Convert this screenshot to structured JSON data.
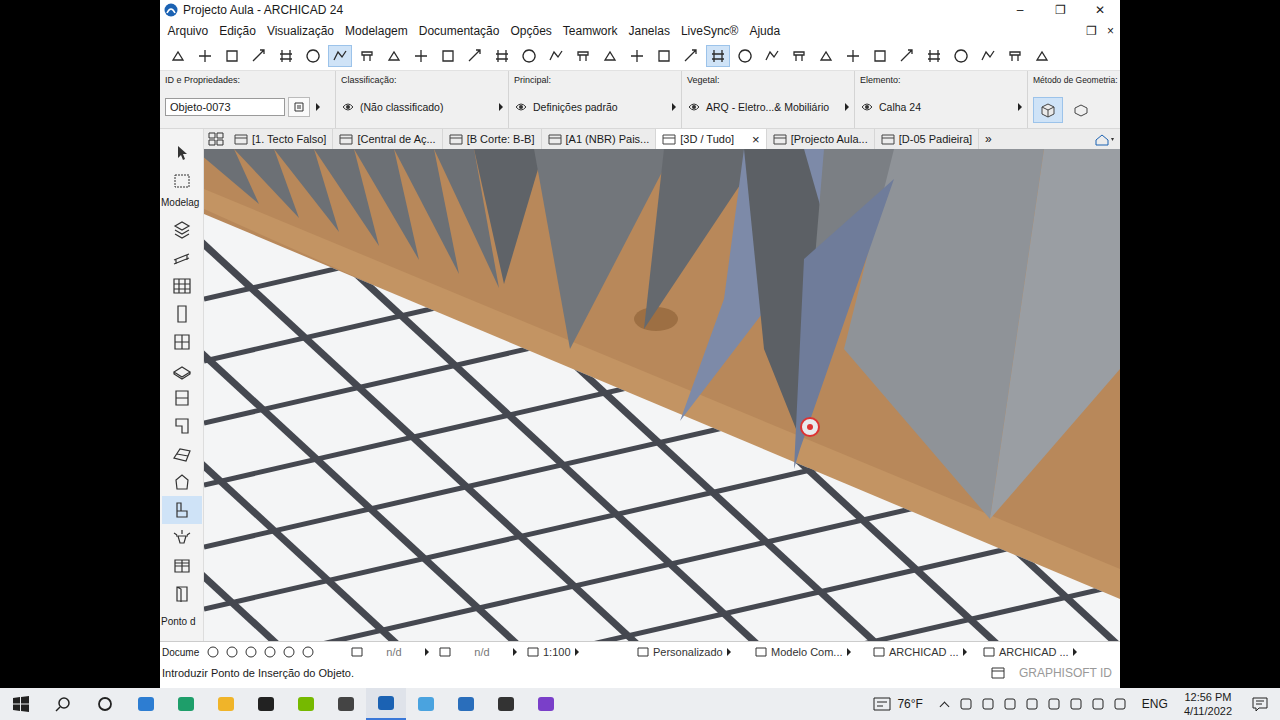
{
  "window": {
    "title": "Projecto Aula - ARCHICAD 24",
    "controls": [
      "–",
      "❐",
      "✕"
    ]
  },
  "menu": {
    "items": [
      "Arquivo",
      "Edição",
      "Visualização",
      "Modelagem",
      "Documentação",
      "Opções",
      "Teamwork",
      "Janelas",
      "LiveSync®",
      "Ajuda"
    ],
    "controls": [
      "❐",
      "×"
    ]
  },
  "toolbar": [
    {
      "selected": false
    },
    {
      "selected": false
    },
    {
      "selected": false
    },
    {
      "selected": false
    },
    {
      "selected": false
    },
    {
      "selected": false
    },
    {
      "selected": true
    },
    {
      "selected": false
    },
    {
      "selected": false
    },
    {
      "selected": false
    },
    {
      "selected": false
    },
    {
      "selected": false
    },
    {
      "selected": false
    },
    {
      "selected": false
    },
    {
      "selected": false
    },
    {
      "selected": false
    },
    {
      "selected": false
    },
    {
      "selected": false
    },
    {
      "selected": false
    },
    {
      "selected": false
    },
    {
      "selected": true
    },
    {
      "selected": false
    },
    {
      "selected": false
    },
    {
      "selected": false
    },
    {
      "selected": false
    },
    {
      "selected": false
    },
    {
      "selected": false
    },
    {
      "selected": false
    },
    {
      "selected": false
    },
    {
      "selected": false
    },
    {
      "selected": false
    },
    {
      "selected": false
    },
    {
      "selected": false
    }
  ],
  "infobox": [
    {
      "kind": "field",
      "label": "ID e Propriedades:",
      "value": "Objeto-0073"
    },
    {
      "kind": "picker",
      "label": "Classificação:",
      "value": "(Não classificado)"
    },
    {
      "kind": "picker",
      "label": "Principal:",
      "value": "Definições padrão"
    },
    {
      "kind": "picker",
      "label": "Vegetal:",
      "value": "ARQ - Eletro...& Mobiliário"
    },
    {
      "kind": "picker",
      "label": "Elemento:",
      "value": "Calha 24"
    },
    {
      "kind": "buttons",
      "label": "Método de Geometria:"
    }
  ],
  "tabs": [
    {
      "label": "[1. Tecto Falso]",
      "selected": false,
      "closable": false
    },
    {
      "label": "[Central de Aç...",
      "selected": false,
      "closable": false
    },
    {
      "label": "[B Corte: B-B]",
      "selected": false,
      "closable": false
    },
    {
      "label": "[A1 (NBR) Pais...",
      "selected": false,
      "closable": false
    },
    {
      "label": "[3D / Tudo]",
      "selected": true,
      "closable": true
    },
    {
      "label": "[Projecto Aula...",
      "selected": false,
      "closable": false
    },
    {
      "label": "[D-05 Padieira]",
      "selected": false,
      "closable": false
    }
  ],
  "tabs_more": "»",
  "tab_close": "×",
  "toolbox": {
    "label": "Modelag",
    "footer": "Ponto d",
    "tools": [
      {
        "selected": false
      },
      {
        "selected": false
      },
      {
        "selected": false
      },
      {
        "selected": false
      },
      {
        "selected": false
      },
      {
        "selected": false
      },
      {
        "selected": false
      },
      {
        "selected": false
      },
      {
        "selected": false
      },
      {
        "selected": false
      },
      {
        "selected": true
      },
      {
        "selected": false
      },
      {
        "selected": false
      },
      {
        "selected": false
      }
    ]
  },
  "viewport_bar": {
    "label": "Docume",
    "items": [
      "n/d",
      "n/d",
      "1:100",
      "Personalizado",
      "Modelo Com...",
      "ARCHICAD ...",
      "ARCHICAD ..."
    ]
  },
  "status": {
    "text": "Introduzir Ponto de Inserção do Objeto.",
    "brand": "GRAPHISOFT ID"
  },
  "taskbar": {
    "apps": [
      {
        "selected": false
      },
      {
        "selected": false
      },
      {
        "selected": false
      },
      {
        "selected": false
      },
      {
        "selected": false
      },
      {
        "selected": false
      },
      {
        "selected": true
      },
      {
        "selected": false
      },
      {
        "selected": false
      },
      {
        "selected": false
      },
      {
        "selected": false
      }
    ],
    "weather": "76°F",
    "language": "ENG",
    "time": "12:56 PM",
    "date": "4/11/2022"
  }
}
